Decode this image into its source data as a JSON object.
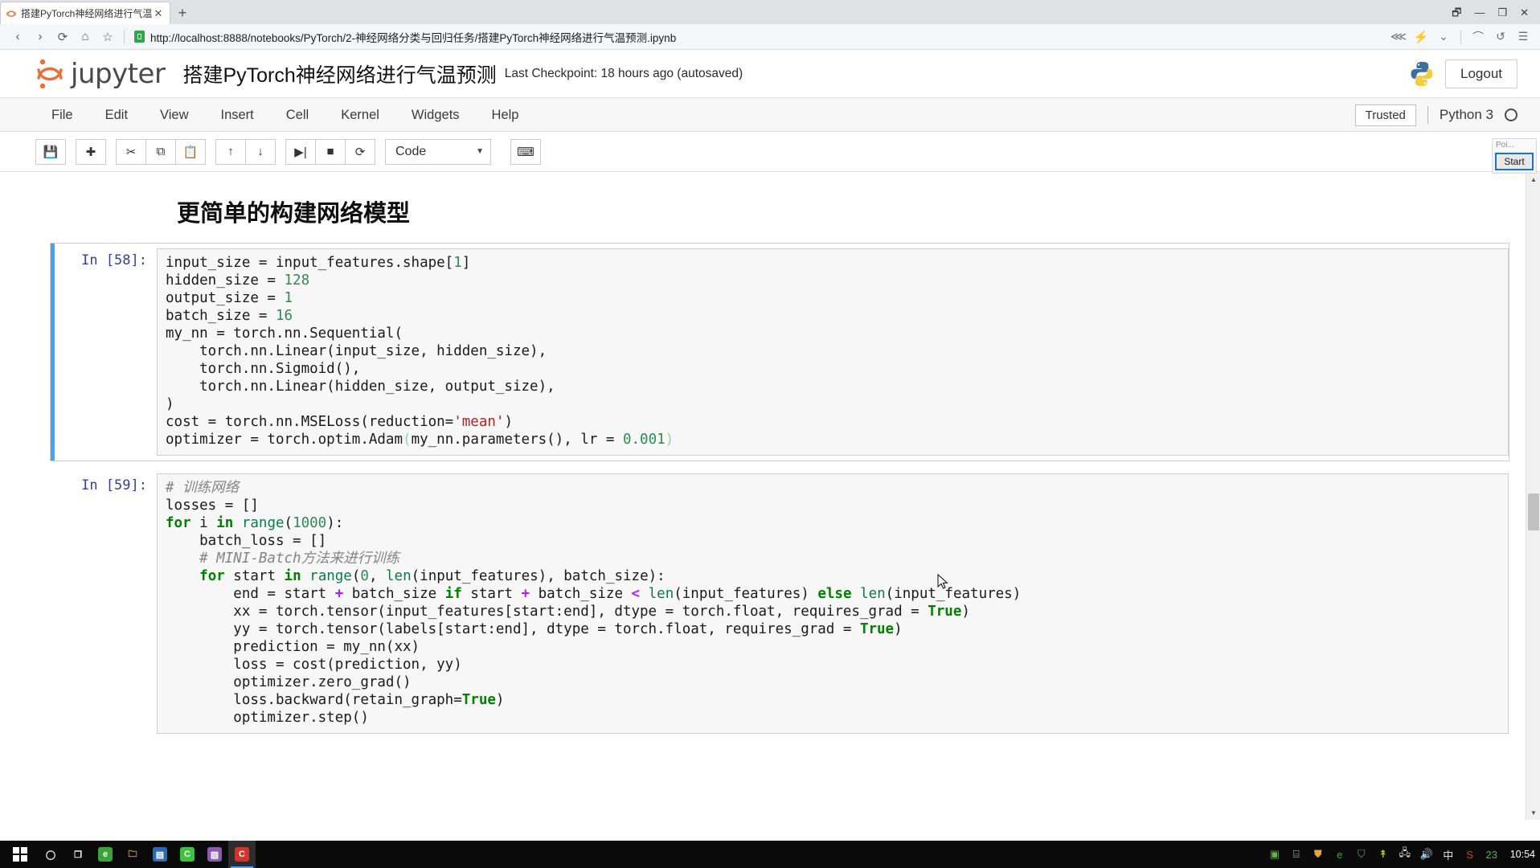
{
  "browser": {
    "tab": {
      "title": "搭建PyTorch神经网络进行气温预",
      "close_label": "✕",
      "favicon": "jupyter-favicon"
    },
    "new_tab_label": "+",
    "window_controls": {
      "restore": "🗗",
      "minimize": "—",
      "maximize": "❐",
      "close": "✕"
    },
    "nav": {
      "back": "‹",
      "forward": "›",
      "reload": "⟳",
      "home": "⌂",
      "bookmark": "☆",
      "url": "http://localhost:8888/notebooks/PyTorch/2-神经网络分类与回归任务/搭建PyTorch神经网络进行气温预测.ipynb",
      "share": "⋘",
      "bolt": "⚡",
      "chevron": "⌄",
      "headphones": "⌒",
      "undo": "↺",
      "menu": "☰"
    }
  },
  "jupyter": {
    "logo_text": "jupyter",
    "notebook_title": "搭建PyTorch神经网络进行气温预测",
    "checkpoint": "Last Checkpoint: 18 hours ago (autosaved)",
    "logout_label": "Logout",
    "menus": [
      "File",
      "Edit",
      "View",
      "Insert",
      "Cell",
      "Kernel",
      "Widgets",
      "Help"
    ],
    "trusted_label": "Trusted",
    "kernel_name": "Python 3",
    "toolbar": {
      "save": "💾",
      "insert_below": "✚",
      "cut": "✂",
      "copy": "⧉",
      "paste": "📋",
      "move_up": "↑",
      "move_down": "↓",
      "run": "▶|",
      "stop": "■",
      "restart": "⟳",
      "cell_type": "Code",
      "cell_type_caret": "▼",
      "keyboard": "⌨"
    }
  },
  "start_widget": {
    "title": "Poi...",
    "button_label": "Start"
  },
  "notebook": {
    "heading": "更简单的构建网络模型",
    "cells": [
      {
        "prompt": "In [58]:",
        "selected": true,
        "lines": [
          [
            {
              "t": "input_size = input_features.shape[",
              "c": ""
            },
            {
              "t": "1",
              "c": "tok-num"
            },
            {
              "t": "]",
              "c": ""
            }
          ],
          [
            {
              "t": "hidden_size = ",
              "c": ""
            },
            {
              "t": "128",
              "c": "tok-num"
            }
          ],
          [
            {
              "t": "output_size = ",
              "c": ""
            },
            {
              "t": "1",
              "c": "tok-num"
            }
          ],
          [
            {
              "t": "batch_size = ",
              "c": ""
            },
            {
              "t": "16",
              "c": "tok-num"
            }
          ],
          [
            {
              "t": "my_nn = torch.nn.Sequential(",
              "c": ""
            }
          ],
          [
            {
              "t": "    torch.nn.Linear(input_size, hidden_size),",
              "c": ""
            }
          ],
          [
            {
              "t": "    torch.nn.Sigmoid(),",
              "c": ""
            }
          ],
          [
            {
              "t": "    torch.nn.Linear(hidden_size, output_size),",
              "c": ""
            }
          ],
          [
            {
              "t": ")",
              "c": ""
            }
          ],
          [
            {
              "t": "cost = torch.nn.MSELoss(reduction=",
              "c": ""
            },
            {
              "t": "'mean'",
              "c": "tok-str"
            },
            {
              "t": ")",
              "c": ""
            }
          ],
          [
            {
              "t": "optimizer = torch.optim.Adam",
              "c": ""
            },
            {
              "t": "(",
              "c": "tok-paren"
            },
            {
              "t": "my_nn.parameters(), lr = ",
              "c": ""
            },
            {
              "t": "0.001",
              "c": "tok-num"
            },
            {
              "t": ")",
              "c": "tok-paren"
            }
          ]
        ]
      },
      {
        "prompt": "In [59]:",
        "selected": false,
        "lines": [
          [
            {
              "t": "# 训练网络",
              "c": "tok-com"
            }
          ],
          [
            {
              "t": "losses = []",
              "c": ""
            }
          ],
          [
            {
              "t": "for",
              "c": "tok-kw"
            },
            {
              "t": " i ",
              "c": ""
            },
            {
              "t": "in",
              "c": "tok-kw"
            },
            {
              "t": " ",
              "c": ""
            },
            {
              "t": "range",
              "c": "tok-fn"
            },
            {
              "t": "(",
              "c": ""
            },
            {
              "t": "1000",
              "c": "tok-num"
            },
            {
              "t": "):",
              "c": ""
            }
          ],
          [
            {
              "t": "    batch_loss = []",
              "c": ""
            }
          ],
          [
            {
              "t": "    # MINI-Batch方法来进行训练",
              "c": "tok-com"
            }
          ],
          [
            {
              "t": "    ",
              "c": ""
            },
            {
              "t": "for",
              "c": "tok-kw"
            },
            {
              "t": " start ",
              "c": ""
            },
            {
              "t": "in",
              "c": "tok-kw"
            },
            {
              "t": " ",
              "c": ""
            },
            {
              "t": "range",
              "c": "tok-fn"
            },
            {
              "t": "(",
              "c": ""
            },
            {
              "t": "0",
              "c": "tok-num"
            },
            {
              "t": ", ",
              "c": ""
            },
            {
              "t": "len",
              "c": "tok-fn"
            },
            {
              "t": "(input_features), batch_size):",
              "c": ""
            }
          ],
          [
            {
              "t": "        end = start ",
              "c": ""
            },
            {
              "t": "+",
              "c": "tok-op"
            },
            {
              "t": " batch_size ",
              "c": ""
            },
            {
              "t": "if",
              "c": "tok-kw"
            },
            {
              "t": " start ",
              "c": ""
            },
            {
              "t": "+",
              "c": "tok-op"
            },
            {
              "t": " batch_size ",
              "c": ""
            },
            {
              "t": "<",
              "c": "tok-op"
            },
            {
              "t": " ",
              "c": ""
            },
            {
              "t": "len",
              "c": "tok-fn"
            },
            {
              "t": "(input_features) ",
              "c": ""
            },
            {
              "t": "else",
              "c": "tok-kw"
            },
            {
              "t": " ",
              "c": ""
            },
            {
              "t": "len",
              "c": "tok-fn"
            },
            {
              "t": "(input_features)",
              "c": ""
            }
          ],
          [
            {
              "t": "        xx = torch.tensor(input_features[start:end], dtype = torch.float, requires_grad = ",
              "c": ""
            },
            {
              "t": "True",
              "c": "tok-kw"
            },
            {
              "t": ")",
              "c": ""
            }
          ],
          [
            {
              "t": "        yy = torch.tensor(labels[start:end], dtype = torch.float, requires_grad = ",
              "c": ""
            },
            {
              "t": "True",
              "c": "tok-kw"
            },
            {
              "t": ")",
              "c": ""
            }
          ],
          [
            {
              "t": "        prediction = my_nn(xx)",
              "c": ""
            }
          ],
          [
            {
              "t": "        loss = cost(prediction, yy)",
              "c": ""
            }
          ],
          [
            {
              "t": "        optimizer.zero_grad()",
              "c": ""
            }
          ],
          [
            {
              "t": "        loss.backward(retain_graph=",
              "c": ""
            },
            {
              "t": "True",
              "c": "tok-kw"
            },
            {
              "t": ")",
              "c": ""
            }
          ],
          [
            {
              "t": "        optimizer.step()",
              "c": ""
            }
          ]
        ]
      }
    ]
  },
  "taskbar": {
    "start_label": "start-button",
    "items": [
      {
        "name": "cortana-icon",
        "glyph": "◯",
        "color": "#ffffff",
        "bg": "transparent",
        "active": false
      },
      {
        "name": "task-view-icon",
        "glyph": "❐",
        "color": "#ffffff",
        "bg": "transparent",
        "active": false
      },
      {
        "name": "edge-icon",
        "glyph": "e",
        "color": "#ffffff",
        "bg": "#3aa33a",
        "active": false
      },
      {
        "name": "file-explorer-icon",
        "glyph": "🗀",
        "color": "#f3c13a",
        "bg": "transparent",
        "active": false
      },
      {
        "name": "office-icon",
        "glyph": "▤",
        "color": "#ffffff",
        "bg": "#2b6cb0",
        "active": false
      },
      {
        "name": "wechat-icon",
        "glyph": "C",
        "color": "#ffffff",
        "bg": "#3ec13e",
        "active": false
      },
      {
        "name": "photos-icon",
        "glyph": "▨",
        "color": "#ffffff",
        "bg": "#8a5bb0",
        "active": false
      },
      {
        "name": "camtasia-icon",
        "glyph": "C",
        "color": "#ffffff",
        "bg": "#d0342c",
        "active": true
      }
    ],
    "tray": [
      {
        "name": "nvidia-icon",
        "glyph": "▣",
        "color": "#6ab04c"
      },
      {
        "name": "usb-icon",
        "glyph": "⌸",
        "color": "#cfcfcf"
      },
      {
        "name": "app-icon",
        "glyph": "⛊",
        "color": "#e8a33d"
      },
      {
        "name": "browser-tray-icon",
        "glyph": "e",
        "color": "#3aa33a"
      },
      {
        "name": "security-shield-icon",
        "glyph": "⛉",
        "color": "#4caf50"
      },
      {
        "name": "update-icon",
        "glyph": "↟",
        "color": "#cddc39"
      },
      {
        "name": "network-icon",
        "glyph": "🖧",
        "color": "#e0e0e0"
      },
      {
        "name": "volume-icon",
        "glyph": "🔊",
        "color": "#e0e0e0"
      },
      {
        "name": "ime-icon",
        "glyph": "中",
        "color": "#e0e0e0"
      },
      {
        "name": "sogou-icon",
        "glyph": "S",
        "color": "#e23b2e"
      },
      {
        "name": "battery-badge-icon",
        "glyph": "23",
        "color": "#3ec13e"
      }
    ],
    "clock": "10:54"
  }
}
